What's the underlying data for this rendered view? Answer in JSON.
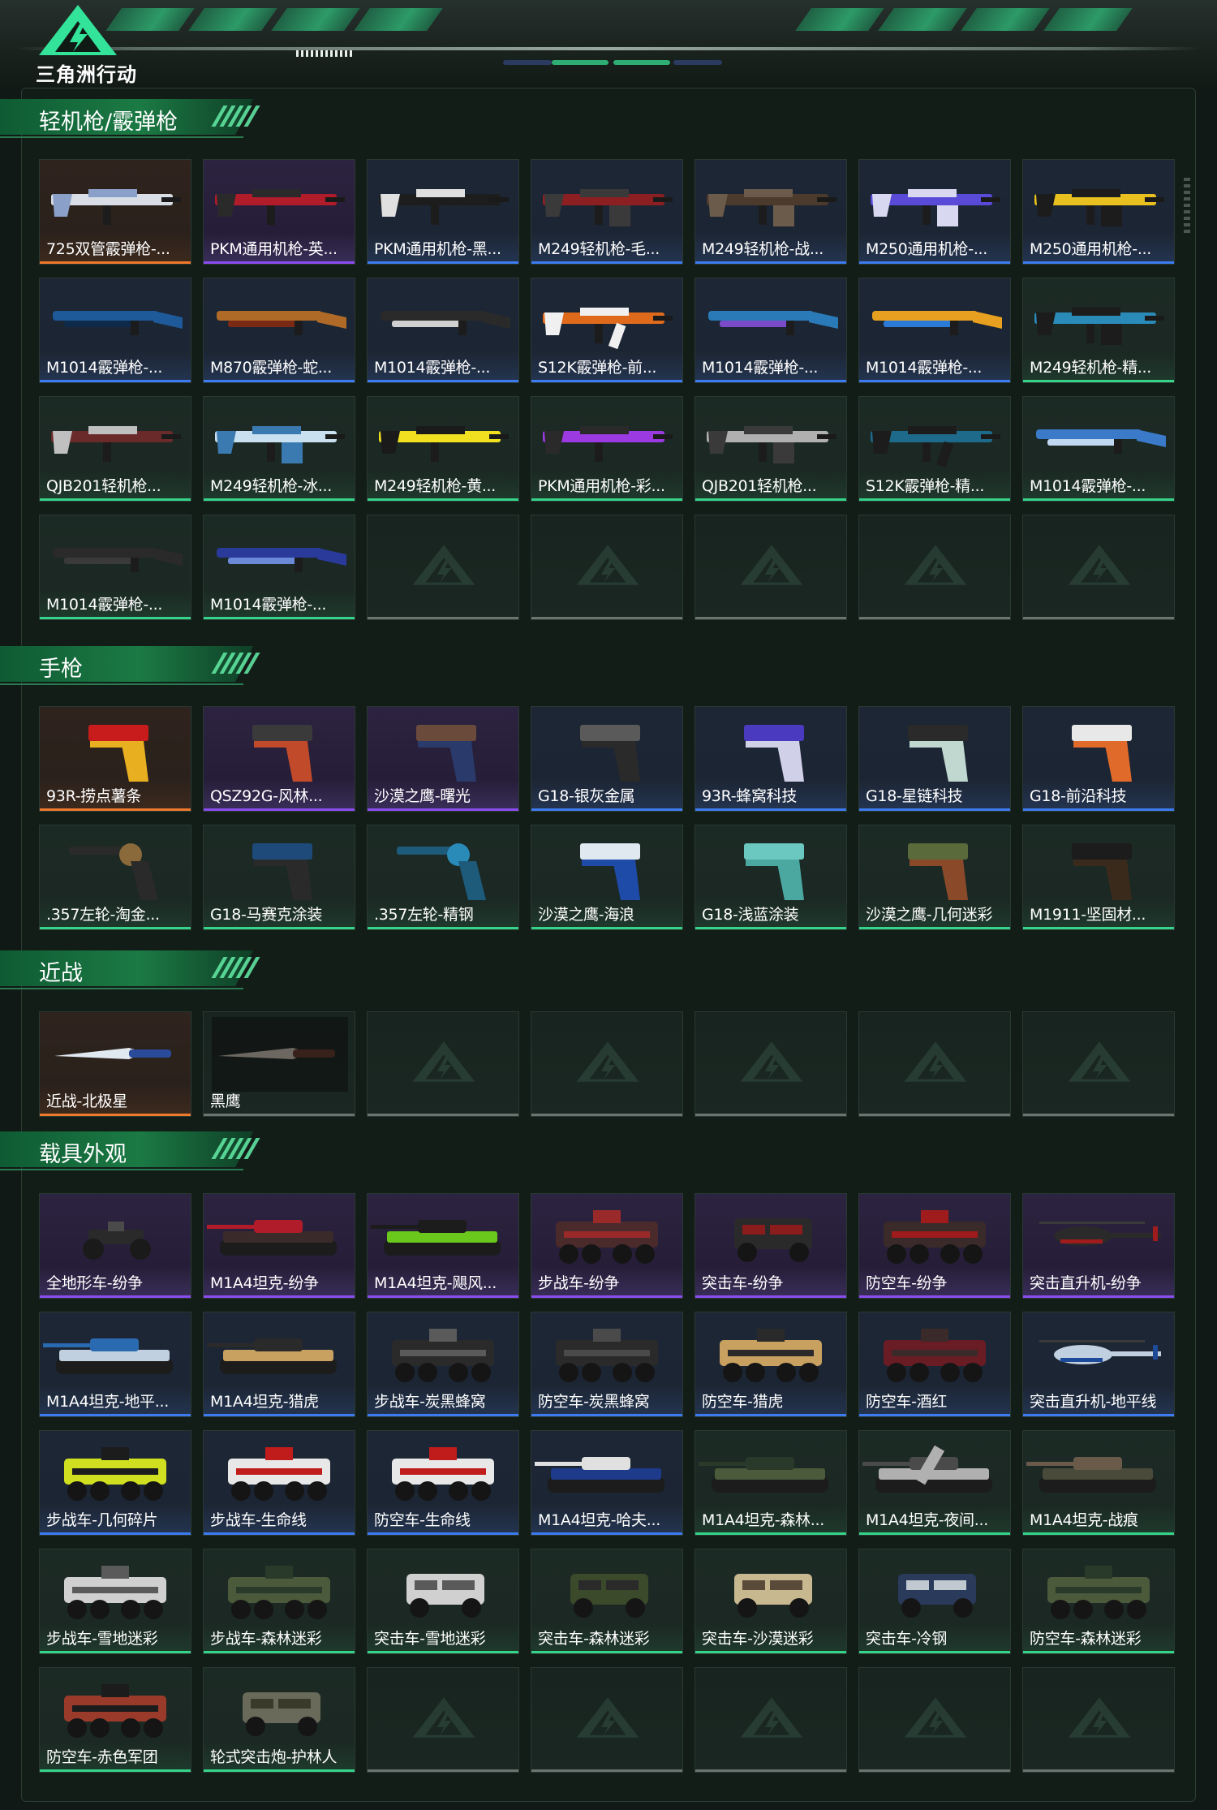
{
  "header": {
    "logo_text": "三角洲行动",
    "colors": {
      "accent": "#2fae73",
      "logo": "#33e39a"
    }
  },
  "sections": [
    {
      "title": "轻机枪/霰弹枪",
      "items": [
        {
          "name": "725双管霰弹枪-...",
          "rarity": "orange",
          "kind": "gun",
          "colors": [
            "#d9dde6",
            "#8aa0c8"
          ]
        },
        {
          "name": "PKM通用机枪-英...",
          "rarity": "purple",
          "kind": "gun",
          "colors": [
            "#b01c2a",
            "#2a2a2a"
          ]
        },
        {
          "name": "PKM通用机枪-黑...",
          "rarity": "blue",
          "kind": "gun",
          "colors": [
            "#1d1d1d",
            "#e0e0e0"
          ]
        },
        {
          "name": "M249轻机枪-毛...",
          "rarity": "blue",
          "kind": "lmg",
          "colors": [
            "#8c1f22",
            "#3a3a3a"
          ]
        },
        {
          "name": "M249轻机枪-战...",
          "rarity": "blue",
          "kind": "lmg",
          "colors": [
            "#4c3a2c",
            "#6b5b4b"
          ]
        },
        {
          "name": "M250通用机枪-...",
          "rarity": "blue",
          "kind": "lmg",
          "colors": [
            "#5a4ad8",
            "#d8d8f0"
          ]
        },
        {
          "name": "M250通用机枪-...",
          "rarity": "blue",
          "kind": "lmg",
          "colors": [
            "#e8c020",
            "#1c1c1c"
          ]
        },
        {
          "name": "M1014霰弹枪-...",
          "rarity": "blue",
          "kind": "shotgun",
          "colors": [
            "#1e5a9a",
            "#0e2a4a"
          ]
        },
        {
          "name": "M870霰弹枪-蛇...",
          "rarity": "blue",
          "kind": "shotgun",
          "colors": [
            "#b06a28",
            "#7a2a14"
          ]
        },
        {
          "name": "M1014霰弹枪-...",
          "rarity": "blue",
          "kind": "shotgun",
          "colors": [
            "#2a2a2a",
            "#d0d0d0"
          ]
        },
        {
          "name": "S12K霰弹枪-前...",
          "rarity": "blue",
          "kind": "rifle",
          "colors": [
            "#e06a1c",
            "#f0f0f0"
          ]
        },
        {
          "name": "M1014霰弹枪-...",
          "rarity": "blue",
          "kind": "shotgun",
          "colors": [
            "#2a7ab8",
            "#7a4ac8"
          ]
        },
        {
          "name": "M1014霰弹枪-...",
          "rarity": "blue",
          "kind": "shotgun",
          "colors": [
            "#e8a020",
            "#2a7ad8"
          ]
        },
        {
          "name": "M249轻机枪-精...",
          "rarity": "green",
          "kind": "lmg",
          "colors": [
            "#2a8ab8",
            "#1c1c1c"
          ]
        },
        {
          "name": "QJB201轻机枪...",
          "rarity": "green",
          "kind": "gun",
          "colors": [
            "#6a2a2a",
            "#c0c0c0"
          ]
        },
        {
          "name": "M249轻机枪-冰...",
          "rarity": "green",
          "kind": "lmg",
          "colors": [
            "#c8e0f0",
            "#3a7ab0"
          ]
        },
        {
          "name": "M249轻机枪-黄...",
          "rarity": "green",
          "kind": "gun",
          "colors": [
            "#f0e020",
            "#1a1a1a"
          ]
        },
        {
          "name": "PKM通用机枪-彩...",
          "rarity": "green",
          "kind": "gun",
          "colors": [
            "#9a3ae0",
            "#2a2a2a"
          ]
        },
        {
          "name": "QJB201轻机枪...",
          "rarity": "green",
          "kind": "lmg",
          "colors": [
            "#b0b0b0",
            "#3a3a3a"
          ]
        },
        {
          "name": "S12K霰弹枪-精...",
          "rarity": "green",
          "kind": "rifle",
          "colors": [
            "#1e6a8a",
            "#1c1c1c"
          ]
        },
        {
          "name": "M1014霰弹枪-...",
          "rarity": "green",
          "kind": "shotgun",
          "colors": [
            "#3a7ac8",
            "#c0d8f0"
          ]
        },
        {
          "name": "M1014霰弹枪-...",
          "rarity": "green",
          "kind": "shotgun",
          "colors": [
            "#2a2a2a",
            "#3a3a3a"
          ]
        },
        {
          "name": "M1014霰弹枪-...",
          "rarity": "green",
          "kind": "shotgun",
          "colors": [
            "#2a3a9a",
            "#6a8ad8"
          ]
        },
        {
          "empty": true
        },
        {
          "empty": true
        },
        {
          "empty": true
        },
        {
          "empty": true
        },
        {
          "empty": true
        }
      ]
    },
    {
      "title": "手枪",
      "items": [
        {
          "name": "93R-捞点薯条",
          "rarity": "orange",
          "kind": "pistol",
          "colors": [
            "#c81c1c",
            "#e8b020"
          ]
        },
        {
          "name": "QSZ92G-风林...",
          "rarity": "purple",
          "kind": "pistol",
          "colors": [
            "#3a3a3a",
            "#c04a2a"
          ]
        },
        {
          "name": "沙漠之鹰-曙光",
          "rarity": "purple",
          "kind": "pistol",
          "colors": [
            "#6a4a3a",
            "#2a3a6a"
          ]
        },
        {
          "name": "G18-银灰金属",
          "rarity": "blue",
          "kind": "pistol",
          "colors": [
            "#5a5a5a",
            "#2a2a2a"
          ]
        },
        {
          "name": "93R-蜂窝科技",
          "rarity": "blue",
          "kind": "pistol",
          "colors": [
            "#4a3ac0",
            "#d0d0e8"
          ]
        },
        {
          "name": "G18-星链科技",
          "rarity": "blue",
          "kind": "pistol",
          "colors": [
            "#2a2a2a",
            "#c0d8d0"
          ]
        },
        {
          "name": "G18-前沿科技",
          "rarity": "blue",
          "kind": "pistol",
          "colors": [
            "#e8e8e8",
            "#e06a2a"
          ]
        },
        {
          "name": ".357左轮-淘金...",
          "rarity": "green",
          "kind": "revolver",
          "colors": [
            "#2a2a2a",
            "#8a6a3a"
          ]
        },
        {
          "name": "G18-马赛克涂装",
          "rarity": "green",
          "kind": "pistol",
          "colors": [
            "#1e4a7a",
            "#2a2a2a"
          ]
        },
        {
          "name": ".357左轮-精钢",
          "rarity": "green",
          "kind": "revolver",
          "colors": [
            "#1e5a7a",
            "#2a8ab8"
          ]
        },
        {
          "name": "沙漠之鹰-海浪",
          "rarity": "green",
          "kind": "pistol",
          "colors": [
            "#e0e8f0",
            "#1e4aa8"
          ]
        },
        {
          "name": "G18-浅蓝涂装",
          "rarity": "green",
          "kind": "pistol",
          "colors": [
            "#6ac8c0",
            "#4aa8a0"
          ]
        },
        {
          "name": "沙漠之鹰-几何迷彩",
          "rarity": "green",
          "kind": "pistol",
          "colors": [
            "#5a6a3a",
            "#8a4a2a"
          ]
        },
        {
          "name": "M1911-坚固材...",
          "rarity": "green",
          "kind": "pistol",
          "colors": [
            "#1c1c1c",
            "#3a2a1c"
          ]
        }
      ]
    },
    {
      "title": "近战",
      "items": [
        {
          "name": "近战-北极星",
          "rarity": "orange",
          "kind": "knife",
          "colors": [
            "#e0e8f0",
            "#2a4a9a"
          ]
        },
        {
          "name": "黑鹰",
          "rarity": "empty-dark",
          "kind": "knife2",
          "colors": [
            "#e0d8c8",
            "#6a3a2a"
          ]
        },
        {
          "empty": true
        },
        {
          "empty": true
        },
        {
          "empty": true
        },
        {
          "empty": true
        },
        {
          "empty": true
        }
      ]
    },
    {
      "title": "载具外观",
      "items": [
        {
          "name": "全地形车-纷争",
          "rarity": "purple",
          "kind": "atv",
          "colors": [
            "#2a2a2a",
            "#4a4a4a"
          ]
        },
        {
          "name": "M1A4坦克-纷争",
          "rarity": "purple",
          "kind": "tank",
          "colors": [
            "#3a2a2a",
            "#b01c2a"
          ]
        },
        {
          "name": "M1A4坦克-飓风...",
          "rarity": "purple",
          "kind": "tank",
          "colors": [
            "#6ac81c",
            "#1c1c1c"
          ]
        },
        {
          "name": "步战车-纷争",
          "rarity": "purple",
          "kind": "apc",
          "colors": [
            "#4a2a2a",
            "#9a2a2a"
          ]
        },
        {
          "name": "突击车-纷争",
          "rarity": "purple",
          "kind": "truck",
          "colors": [
            "#2a2a2a",
            "#8a1c1c"
          ]
        },
        {
          "name": "防空车-纷争",
          "rarity": "purple",
          "kind": "apc",
          "colors": [
            "#3a2a2a",
            "#a01c1c"
          ]
        },
        {
          "name": "突击直升机-纷争",
          "rarity": "purple",
          "kind": "heli",
          "colors": [
            "#2a2a2a",
            "#a01c1c"
          ]
        },
        {
          "name": "M1A4坦克-地平...",
          "rarity": "blue",
          "kind": "tank",
          "colors": [
            "#c0d0e0",
            "#2a6ab0"
          ]
        },
        {
          "name": "M1A4坦克-猎虎",
          "rarity": "blue",
          "kind": "tank",
          "colors": [
            "#c8a060",
            "#2a2a2a"
          ]
        },
        {
          "name": "步战车-炭黑蜂窝",
          "rarity": "blue",
          "kind": "apc",
          "colors": [
            "#2a2a2a",
            "#5a5a5a"
          ]
        },
        {
          "name": "防空车-炭黑蜂窝",
          "rarity": "blue",
          "kind": "apc",
          "colors": [
            "#2a2a2a",
            "#4a4a4a"
          ]
        },
        {
          "name": "防空车-猎虎",
          "rarity": "blue",
          "kind": "apc",
          "colors": [
            "#c8a060",
            "#2a2a2a"
          ]
        },
        {
          "name": "防空车-酒红",
          "rarity": "blue",
          "kind": "apc",
          "colors": [
            "#6a1c24",
            "#3a2a2a"
          ]
        },
        {
          "name": "突击直升机-地平线",
          "rarity": "blue",
          "kind": "heli",
          "colors": [
            "#c0d0e0",
            "#1e4a9a"
          ]
        },
        {
          "name": "步战车-几何碎片",
          "rarity": "blue",
          "kind": "apc",
          "colors": [
            "#d0e020",
            "#1c1c1c"
          ]
        },
        {
          "name": "步战车-生命线",
          "rarity": "blue",
          "kind": "apc",
          "colors": [
            "#e8e8e8",
            "#c01c1c"
          ]
        },
        {
          "name": "防空车-生命线",
          "rarity": "blue",
          "kind": "apc",
          "colors": [
            "#e8e8e8",
            "#c01c1c"
          ]
        },
        {
          "name": "M1A4坦克-哈夫...",
          "rarity": "blue",
          "kind": "tank",
          "colors": [
            "#1e3a8a",
            "#e0e0e0"
          ]
        },
        {
          "name": "M1A4坦克-森林...",
          "rarity": "green",
          "kind": "tank",
          "colors": [
            "#4a5a3a",
            "#2a3a2a"
          ]
        },
        {
          "name": "M1A4坦克-夜间...",
          "rarity": "green",
          "kind": "tank2",
          "colors": [
            "#b0b0b0",
            "#4a4a4a"
          ]
        },
        {
          "name": "M1A4坦克-战痕",
          "rarity": "green",
          "kind": "tank",
          "colors": [
            "#4a4a3a",
            "#6a5a4a"
          ]
        },
        {
          "name": "步战车-雪地迷彩",
          "rarity": "green",
          "kind": "apc",
          "colors": [
            "#d0d0d0",
            "#5a5a5a"
          ]
        },
        {
          "name": "步战车-森林迷彩",
          "rarity": "green",
          "kind": "apc",
          "colors": [
            "#4a5a3a",
            "#2a3a2a"
          ]
        },
        {
          "name": "突击车-雪地迷彩",
          "rarity": "green",
          "kind": "truck",
          "colors": [
            "#d0d0d0",
            "#5a5a5a"
          ]
        },
        {
          "name": "突击车-森林迷彩",
          "rarity": "green",
          "kind": "truck",
          "colors": [
            "#3a4a2a",
            "#2a2a2a"
          ]
        },
        {
          "name": "突击车-沙漠迷彩",
          "rarity": "green",
          "kind": "truck",
          "colors": [
            "#c8b890",
            "#5a4a3a"
          ]
        },
        {
          "name": "突击车-冷钢",
          "rarity": "green",
          "kind": "truck",
          "colors": [
            "#2a3a5a",
            "#c0c8d0"
          ]
        },
        {
          "name": "防空车-森林迷彩",
          "rarity": "green",
          "kind": "apc",
          "colors": [
            "#4a5a3a",
            "#2a3a2a"
          ]
        },
        {
          "name": "防空车-赤色军团",
          "rarity": "green",
          "kind": "apc",
          "colors": [
            "#9a3a2a",
            "#1c1c1c"
          ]
        },
        {
          "name": "轮式突击炮-护林人",
          "rarity": "green",
          "kind": "truck",
          "colors": [
            "#6a6a5a",
            "#3a3a2a"
          ]
        },
        {
          "empty": true
        },
        {
          "empty": true
        },
        {
          "empty": true
        },
        {
          "empty": true
        },
        {
          "empty": true
        }
      ]
    }
  ]
}
